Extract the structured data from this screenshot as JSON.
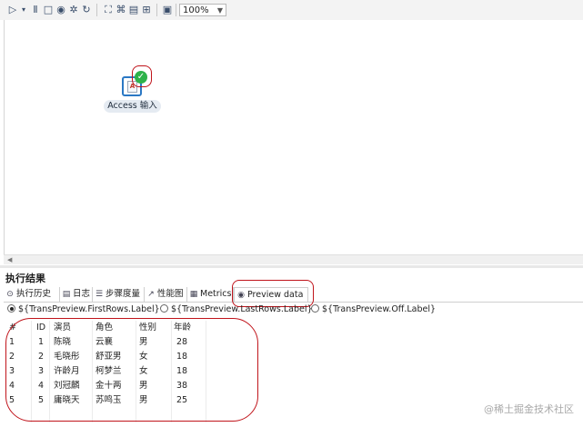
{
  "toolbar": {
    "icons": [
      "play-icon",
      "play-options-icon",
      "pause-icon",
      "stop-icon",
      "preview-icon",
      "debug-icon",
      "replay-icon",
      "verify-icon",
      "analyze-icon",
      "sql-icon",
      "explore-db-icon",
      "show-results-icon"
    ],
    "zoom": "100%"
  },
  "canvas": {
    "step_label": "Access 输入"
  },
  "results": {
    "title": "执行结果",
    "tabs": [
      {
        "label": "执行历史",
        "icon": "history-icon"
      },
      {
        "label": "日志",
        "icon": "log-icon"
      },
      {
        "label": "步骤度量",
        "icon": "step-metrics-icon"
      },
      {
        "label": "性能图",
        "icon": "performance-graph-icon"
      },
      {
        "label": "Metrics",
        "icon": "metrics-icon"
      },
      {
        "label": "Preview data",
        "icon": "eye-icon"
      }
    ],
    "radios": [
      {
        "label": "${TransPreview.FirstRows.Label}",
        "checked": true
      },
      {
        "label": "${TransPreview.LastRows.Label}",
        "checked": false
      },
      {
        "label": "${TransPreview.Off.Label}",
        "checked": false
      }
    ],
    "table": {
      "columns": [
        "#",
        "ID",
        "演员",
        "角色",
        "性别",
        "年龄"
      ],
      "rows": [
        [
          "1",
          "1",
          "陈晓",
          "云襄",
          "男",
          "28"
        ],
        [
          "2",
          "2",
          "毛晓彤",
          "舒亚男",
          "女",
          "18"
        ],
        [
          "3",
          "3",
          "许龄月",
          "柯梦兰",
          "女",
          "18"
        ],
        [
          "4",
          "4",
          "刘冠麟",
          "金十两",
          "男",
          "38"
        ],
        [
          "5",
          "5",
          "庸晓天",
          "苏鸣玉",
          "男",
          "25"
        ]
      ]
    }
  },
  "watermark": "@稀土掘金技术社区"
}
